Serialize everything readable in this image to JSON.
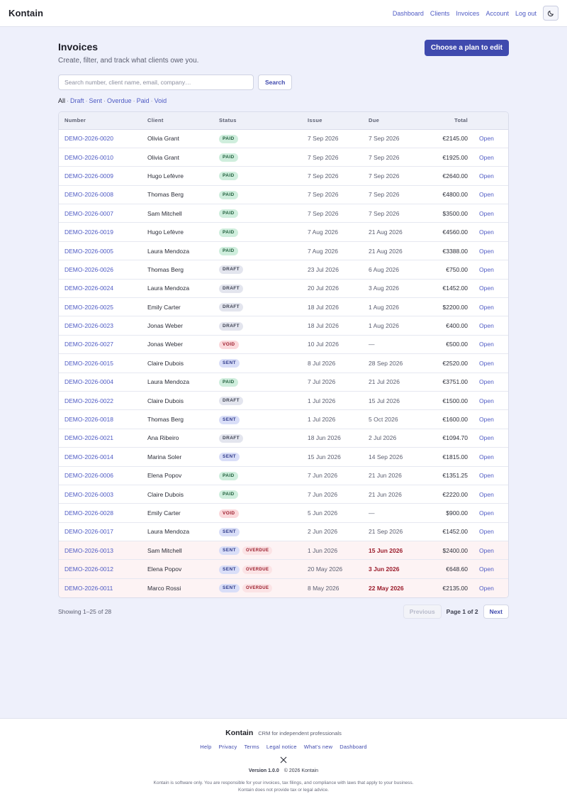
{
  "header": {
    "brand": "Kontain",
    "nav": [
      "Dashboard",
      "Clients",
      "Invoices",
      "Account",
      "Log out"
    ],
    "theme_icon": "moon-icon"
  },
  "page": {
    "title": "Invoices",
    "subtitle": "Create, filter, and track what clients owe you.",
    "cta_label": "Choose a plan to edit"
  },
  "search": {
    "placeholder": "Search number, client name, email, company…",
    "value": "",
    "button_label": "Search"
  },
  "filters": {
    "items": [
      "All",
      "Draft",
      "Sent",
      "Overdue",
      "Paid",
      "Void"
    ],
    "active": "All"
  },
  "table": {
    "columns": [
      "Number",
      "Client",
      "Status",
      "Issue",
      "Due",
      "Total",
      ""
    ],
    "open_label": "Open",
    "overdue_label": "OVERDUE",
    "rows": [
      {
        "number": "DEMO-2026-0020",
        "client": "Olivia Grant",
        "status": "PAID",
        "issue": "7 Sep 2026",
        "due": "7 Sep 2026",
        "total": "€2145.00",
        "overdue": false
      },
      {
        "number": "DEMO-2026-0010",
        "client": "Olivia Grant",
        "status": "PAID",
        "issue": "7 Sep 2026",
        "due": "7 Sep 2026",
        "total": "€1925.00",
        "overdue": false
      },
      {
        "number": "DEMO-2026-0009",
        "client": "Hugo Lefèvre",
        "status": "PAID",
        "issue": "7 Sep 2026",
        "due": "7 Sep 2026",
        "total": "€2640.00",
        "overdue": false
      },
      {
        "number": "DEMO-2026-0008",
        "client": "Thomas Berg",
        "status": "PAID",
        "issue": "7 Sep 2026",
        "due": "7 Sep 2026",
        "total": "€4800.00",
        "overdue": false
      },
      {
        "number": "DEMO-2026-0007",
        "client": "Sam Mitchell",
        "status": "PAID",
        "issue": "7 Sep 2026",
        "due": "7 Sep 2026",
        "total": "$3500.00",
        "overdue": false
      },
      {
        "number": "DEMO-2026-0019",
        "client": "Hugo Lefèvre",
        "status": "PAID",
        "issue": "7 Aug 2026",
        "due": "21 Aug 2026",
        "total": "€4560.00",
        "overdue": false
      },
      {
        "number": "DEMO-2026-0005",
        "client": "Laura Mendoza",
        "status": "PAID",
        "issue": "7 Aug 2026",
        "due": "21 Aug 2026",
        "total": "€3388.00",
        "overdue": false
      },
      {
        "number": "DEMO-2026-0026",
        "client": "Thomas Berg",
        "status": "DRAFT",
        "issue": "23 Jul 2026",
        "due": "6 Aug 2026",
        "total": "€750.00",
        "overdue": false
      },
      {
        "number": "DEMO-2026-0024",
        "client": "Laura Mendoza",
        "status": "DRAFT",
        "issue": "20 Jul 2026",
        "due": "3 Aug 2026",
        "total": "€1452.00",
        "overdue": false
      },
      {
        "number": "DEMO-2026-0025",
        "client": "Emily Carter",
        "status": "DRAFT",
        "issue": "18 Jul 2026",
        "due": "1 Aug 2026",
        "total": "$2200.00",
        "overdue": false
      },
      {
        "number": "DEMO-2026-0023",
        "client": "Jonas Weber",
        "status": "DRAFT",
        "issue": "18 Jul 2026",
        "due": "1 Aug 2026",
        "total": "€400.00",
        "overdue": false
      },
      {
        "number": "DEMO-2026-0027",
        "client": "Jonas Weber",
        "status": "VOID",
        "issue": "10 Jul 2026",
        "due": "—",
        "total": "€500.00",
        "overdue": false
      },
      {
        "number": "DEMO-2026-0015",
        "client": "Claire Dubois",
        "status": "SENT",
        "issue": "8 Jul 2026",
        "due": "28 Sep 2026",
        "total": "€2520.00",
        "overdue": false
      },
      {
        "number": "DEMO-2026-0004",
        "client": "Laura Mendoza",
        "status": "PAID",
        "issue": "7 Jul 2026",
        "due": "21 Jul 2026",
        "total": "€3751.00",
        "overdue": false
      },
      {
        "number": "DEMO-2026-0022",
        "client": "Claire Dubois",
        "status": "DRAFT",
        "issue": "1 Jul 2026",
        "due": "15 Jul 2026",
        "total": "€1500.00",
        "overdue": false
      },
      {
        "number": "DEMO-2026-0018",
        "client": "Thomas Berg",
        "status": "SENT",
        "issue": "1 Jul 2026",
        "due": "5 Oct 2026",
        "total": "€1600.00",
        "overdue": false
      },
      {
        "number": "DEMO-2026-0021",
        "client": "Ana Ribeiro",
        "status": "DRAFT",
        "issue": "18 Jun 2026",
        "due": "2 Jul 2026",
        "total": "€1094.70",
        "overdue": false
      },
      {
        "number": "DEMO-2026-0014",
        "client": "Marina Soler",
        "status": "SENT",
        "issue": "15 Jun 2026",
        "due": "14 Sep 2026",
        "total": "€1815.00",
        "overdue": false
      },
      {
        "number": "DEMO-2026-0006",
        "client": "Elena Popov",
        "status": "PAID",
        "issue": "7 Jun 2026",
        "due": "21 Jun 2026",
        "total": "€1351.25",
        "overdue": false
      },
      {
        "number": "DEMO-2026-0003",
        "client": "Claire Dubois",
        "status": "PAID",
        "issue": "7 Jun 2026",
        "due": "21 Jun 2026",
        "total": "€2220.00",
        "overdue": false
      },
      {
        "number": "DEMO-2026-0028",
        "client": "Emily Carter",
        "status": "VOID",
        "issue": "5 Jun 2026",
        "due": "—",
        "total": "$900.00",
        "overdue": false
      },
      {
        "number": "DEMO-2026-0017",
        "client": "Laura Mendoza",
        "status": "SENT",
        "issue": "2 Jun 2026",
        "due": "21 Sep 2026",
        "total": "€1452.00",
        "overdue": false
      },
      {
        "number": "DEMO-2026-0013",
        "client": "Sam Mitchell",
        "status": "SENT",
        "issue": "1 Jun 2026",
        "due": "15 Jun 2026",
        "total": "$2400.00",
        "overdue": true
      },
      {
        "number": "DEMO-2026-0012",
        "client": "Elena Popov",
        "status": "SENT",
        "issue": "20 May 2026",
        "due": "3 Jun 2026",
        "total": "€648.60",
        "overdue": true
      },
      {
        "number": "DEMO-2026-0011",
        "client": "Marco Rossi",
        "status": "SENT",
        "issue": "8 May 2026",
        "due": "22 May 2026",
        "total": "€2135.00",
        "overdue": true
      }
    ]
  },
  "pagination": {
    "showing": "Showing 1–25 of 28",
    "previous_label": "Previous",
    "page_info": "Page 1 of 2",
    "next_label": "Next"
  },
  "footer": {
    "brand": "Kontain",
    "tagline": "CRM for independent professionals",
    "links": [
      "Help",
      "Privacy",
      "Terms",
      "Legal notice",
      "What's new",
      "Dashboard"
    ],
    "social_icon": "x-logo-icon",
    "version": "Version 1.0.0",
    "copyright": "© 2026 Kontain",
    "disclaimer": "Kontain is software only. You are responsible for your invoices, tax filings, and compliance with laws that apply to your business. Kontain does not provide tax or legal advice."
  },
  "colors": {
    "accent": "#3f4aae",
    "link": "#4f5bc4",
    "background": "#eef0fb",
    "overdue_text": "#9b1c2b"
  }
}
